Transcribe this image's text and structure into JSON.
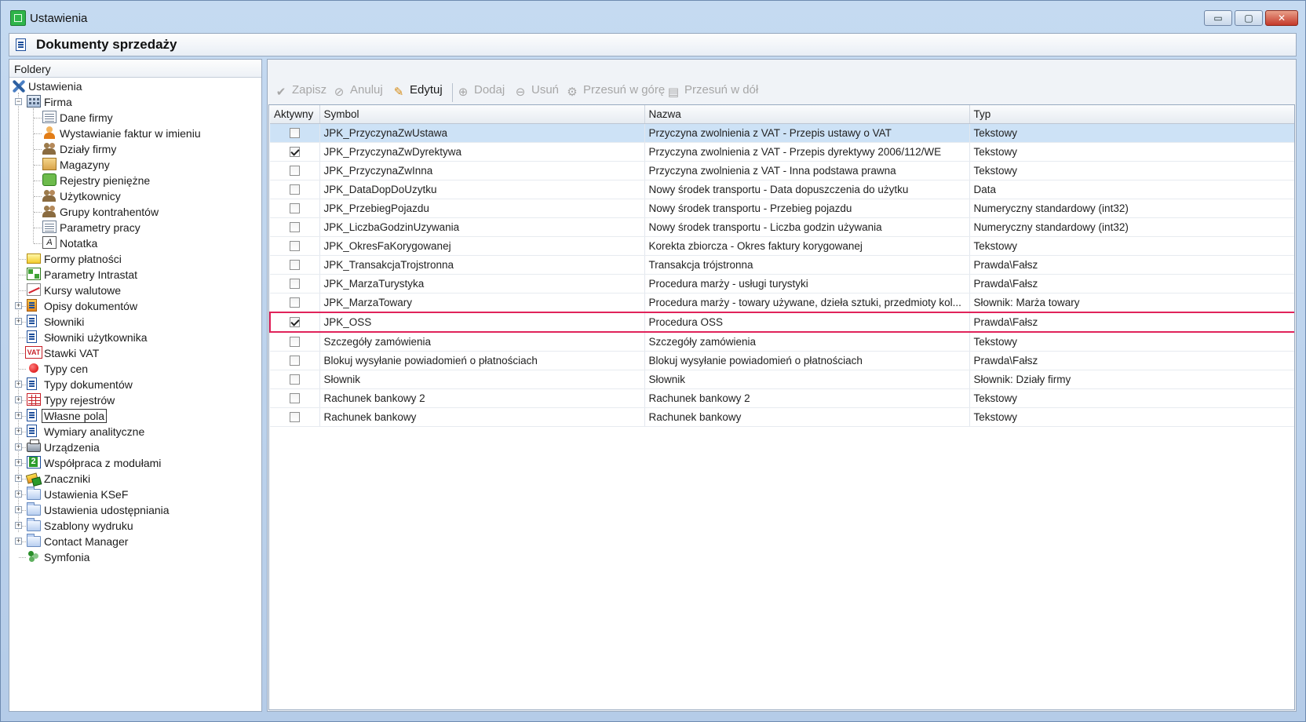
{
  "window": {
    "title": "Ustawienia",
    "controls": {
      "minimize": "▭",
      "maximize": "▢",
      "close": "✕"
    }
  },
  "header": {
    "title": "Dokumenty sprzedaży"
  },
  "left_panel": {
    "title": "Foldery",
    "tree": {
      "root": "Ustawienia",
      "firma": "Firma",
      "firma_children": [
        "Dane firmy",
        "Wystawianie faktur w imieniu",
        "Działy firmy",
        "Magazyny",
        "Rejestry pieniężne",
        "Użytkownicy",
        "Grupy kontrahentów",
        "Parametry pracy",
        "Notatka"
      ],
      "items": [
        "Formy płatności",
        "Parametry Intrastat",
        "Kursy walutowe",
        "Opisy dokumentów",
        "Słowniki",
        "Słowniki użytkownika",
        "Stawki VAT",
        "Typy cen",
        "Typy dokumentów",
        "Typy rejestrów",
        "Własne pola",
        "Wymiary analityczne",
        "Urządzenia",
        "Współpraca z modułami",
        "Znaczniki",
        "Ustawienia KSeF",
        "Ustawienia udostępniania",
        "Szablony wydruku",
        "Contact Manager",
        "Symfonia"
      ],
      "selected": "Własne pola",
      "vat_badge": "VAT",
      "note_glyph": "A"
    }
  },
  "toolbar": {
    "buttons": [
      {
        "label": "Zapisz",
        "icon": "checkmark-icon",
        "enabled": false
      },
      {
        "label": "Anuluj",
        "icon": "cancel-icon",
        "enabled": false
      },
      {
        "label": "Edytuj",
        "icon": "pencil-icon",
        "enabled": true
      },
      {
        "label": "Dodaj",
        "icon": "plus-icon",
        "enabled": false
      },
      {
        "label": "Usuń",
        "icon": "minus-icon",
        "enabled": false
      },
      {
        "label": "Przesuń w górę",
        "icon": "move-up-icon",
        "enabled": false
      },
      {
        "label": "Przesuń w dół",
        "icon": "move-down-icon",
        "enabled": false
      }
    ]
  },
  "grid": {
    "columns": [
      "Aktywny",
      "Symbol",
      "Nazwa",
      "Typ"
    ],
    "rows": [
      {
        "active": false,
        "symbol": "JPK_PrzyczynaZwUstawa",
        "name": "Przyczyna zwolnienia z VAT - Przepis ustawy o VAT",
        "type": "Tekstowy"
      },
      {
        "active": true,
        "symbol": "JPK_PrzyczynaZwDyrektywa",
        "name": "Przyczyna zwolnienia z VAT - Przepis dyrektywy 2006/112/WE",
        "type": "Tekstowy"
      },
      {
        "active": false,
        "symbol": "JPK_PrzyczynaZwInna",
        "name": "Przyczyna zwolnienia z VAT - Inna podstawa prawna",
        "type": "Tekstowy"
      },
      {
        "active": false,
        "symbol": "JPK_DataDopDoUzytku",
        "name": "Nowy środek transportu - Data dopuszczenia do użytku",
        "type": "Data"
      },
      {
        "active": false,
        "symbol": "JPK_PrzebiegPojazdu",
        "name": "Nowy środek transportu - Przebieg pojazdu",
        "type": "Numeryczny standardowy (int32)"
      },
      {
        "active": false,
        "symbol": "JPK_LiczbaGodzinUzywania",
        "name": "Nowy środek transportu - Liczba godzin używania",
        "type": "Numeryczny standardowy (int32)"
      },
      {
        "active": false,
        "symbol": "JPK_OkresFaKorygowanej",
        "name": "Korekta zbiorcza - Okres faktury korygowanej",
        "type": "Tekstowy"
      },
      {
        "active": false,
        "symbol": "JPK_TransakcjaTrojstronna",
        "name": "Transakcja trójstronna",
        "type": "Prawda\\Fałsz"
      },
      {
        "active": false,
        "symbol": "JPK_MarzaTurystyka",
        "name": "Procedura marży - usługi turystyki",
        "type": "Prawda\\Fałsz"
      },
      {
        "active": false,
        "symbol": "JPK_MarzaTowary",
        "name": "Procedura marży - towary używane, dzieła sztuki, przedmioty kol...",
        "type": "Słownik: Marża towary"
      },
      {
        "active": true,
        "symbol": "JPK_OSS",
        "name": "Procedura OSS",
        "type": "Prawda\\Fałsz"
      },
      {
        "active": false,
        "symbol": "Szczegóły zamówienia",
        "name": "Szczegóły zamówienia",
        "type": "Tekstowy"
      },
      {
        "active": false,
        "symbol": "Blokuj wysyłanie powiadomień o płatnościach",
        "name": "Blokuj wysyłanie powiadomień o płatnościach",
        "type": "Prawda\\Fałsz"
      },
      {
        "active": false,
        "symbol": "Słownik",
        "name": "Słownik",
        "type": "Słownik: Działy firmy"
      },
      {
        "active": false,
        "symbol": "Rachunek bankowy 2",
        "name": "Rachunek bankowy 2",
        "type": "Tekstowy"
      },
      {
        "active": false,
        "symbol": "Rachunek bankowy",
        "name": "Rachunek bankowy",
        "type": "Tekstowy"
      }
    ],
    "selected_row": 0,
    "highlighted_row": 10
  },
  "colors": {
    "selection": "#cde2f6",
    "highlight_border": "#e0235a",
    "window_frame": "#bcd3ec"
  }
}
